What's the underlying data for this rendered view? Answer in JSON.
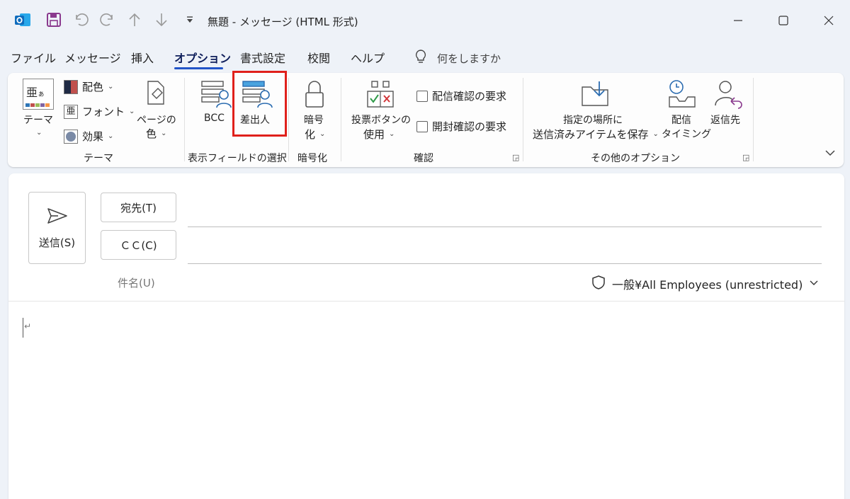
{
  "window": {
    "title": "無題 - メッセージ (HTML 形式)"
  },
  "menu": {
    "tabs": [
      "ファイル",
      "メッセージ",
      "挿入",
      "オプション",
      "書式設定",
      "校閲",
      "ヘルプ"
    ],
    "active_tab": "オプション",
    "tell_me": "何をしますか"
  },
  "ribbon": {
    "theme": {
      "theme_label": "テーマ",
      "colors_label": "配色",
      "fonts_label": "フォント",
      "effects_label": "効果",
      "page_color_label_1": "ページの",
      "page_color_label_2": "色",
      "group_label": "テーマ"
    },
    "fields": {
      "bcc_label": "BCC",
      "from_label": "差出人",
      "group_label": "表示フィールドの選択"
    },
    "encrypt": {
      "label_1": "暗号",
      "label_2": "化",
      "group_label": "暗号化"
    },
    "tracking": {
      "voting_label_1": "投票ボタンの",
      "voting_label_2": "使用",
      "delivery_receipt": "配信確認の要求",
      "read_receipt": "開封確認の要求",
      "group_label": "確認"
    },
    "more": {
      "save_sent_1": "指定の場所に",
      "save_sent_2": "送信済みアイテムを保存",
      "delay_1": "配信",
      "delay_2": "タイミング",
      "reply_to": "返信先",
      "group_label": "その他のオプション"
    }
  },
  "compose": {
    "send_label": "送信(S)",
    "to_label": "宛先(T)",
    "cc_label": "ＣＣ(C)",
    "subject_label": "件名(U)",
    "sensitivity": "一般¥All Employees (unrestricted)",
    "paragraph_mark": "↵"
  },
  "colors": {
    "accent": "#2254c8",
    "highlight": "#e0201b",
    "outlook_blue": "#0f6cbd",
    "save_purple": "#8a3a8e"
  }
}
